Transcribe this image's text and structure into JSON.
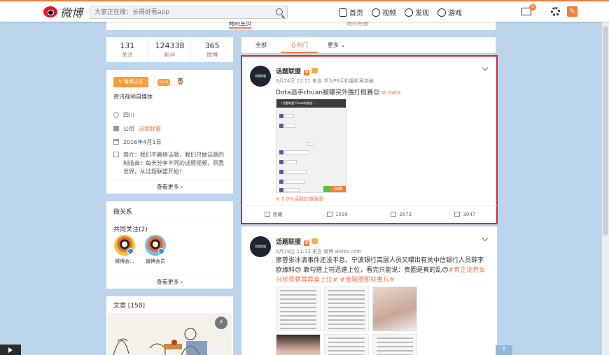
{
  "header": {
    "logo_text": "微博",
    "search_placeholder": "大家正在搜：长得好看app",
    "nav": [
      "首页",
      "视频",
      "发现",
      "游戏"
    ],
    "mail_badge": "4",
    "edit_glyph": "✎"
  },
  "top_tabs": {
    "left": "她的主页",
    "right": "她的相册"
  },
  "stats": [
    {
      "num": "131",
      "label": "关注"
    },
    {
      "num": "124338",
      "label": "粉丝"
    },
    {
      "num": "365",
      "label": "微博"
    }
  ],
  "profile": {
    "verify_label": "V 微博认证",
    "level": "Lv.4",
    "medal": "🦉",
    "intro": "资讯视频自媒体",
    "location": "四川",
    "company_prefix": "公司",
    "company": "话题联盟",
    "birthday": "2016年4月1日",
    "desc": "简介：我们不搬移话题，我们只做话题的制造商！每天分享不同的话题视频，洞悉世界，从话题联盟开始！",
    "more": "查看更多 ›"
  },
  "relations": {
    "title": "微关系",
    "subtitle": "共同关注(2)",
    "friends": [
      "微博会...",
      "微博会员"
    ],
    "more": "查看更多 ›"
  },
  "articles": {
    "title": "文章 [158]",
    "flash": "⚡"
  },
  "filters": {
    "all": "全部",
    "hot": "热门",
    "more": "更多 ⌄"
  },
  "post1": {
    "avatar_text": "话题联盟",
    "name": "话题联盟",
    "v": "V",
    "meta": "9月24日 12:21 来自 华为P9手机摄影再突破",
    "text": "Dota选手chuan被曝买外围打假赛😊",
    "tag": "⊘ dota",
    "shot_title": "〈 话题联盟      Chuan的微信 ...",
    "shot_tag": "长图",
    "link": "⊘ 0.0%话题的微微圈",
    "actions": [
      "收藏",
      "1099",
      "2673",
      "3047"
    ]
  },
  "post2": {
    "avatar_text": "话题联盟",
    "name": "话题联盟",
    "v": "V",
    "meta": "9月19日 11:13 来自 微博 weibo.com",
    "text_a": "廖蓉张冰清事件还没平息，宁波银行高层人员又曝出有关中信银行人员薛李欧缘料😊 靠勾搭上司迅速上位，看完只能说：贵圈是真的乱😊",
    "text_tag": "#宵正证券女分析师蔡蓉蓉桌上位# #金融圈那些事儿#"
  }
}
